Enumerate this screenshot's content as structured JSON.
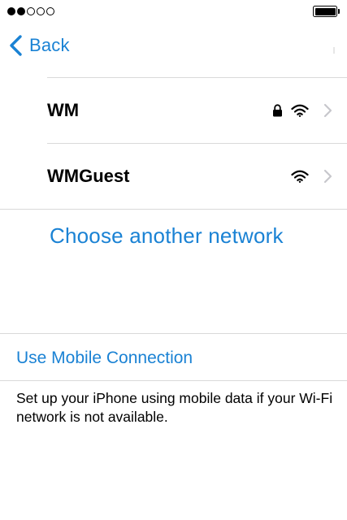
{
  "nav": {
    "back_label": "Back"
  },
  "networks": [
    {
      "name": "WM",
      "secured": true,
      "icons": [
        "lock-icon",
        "wifi-icon",
        "chevron-right-icon"
      ]
    },
    {
      "name": "WMGuest",
      "secured": false,
      "icons": [
        "wifi-icon",
        "chevron-right-icon"
      ]
    }
  ],
  "choose_network_label": "Choose another network",
  "mobile": {
    "label": "Use Mobile Connection",
    "description": "Set up your iPhone using mobile data if your Wi-Fi network is not available."
  },
  "status_bar": {
    "signal_strength": 2,
    "signal_max": 5,
    "battery_level": 1.0
  },
  "colors": {
    "accent": "#1a82d4",
    "separator": "#d9d9d9",
    "text": "#000000",
    "chevron": "#c7c7cc"
  }
}
